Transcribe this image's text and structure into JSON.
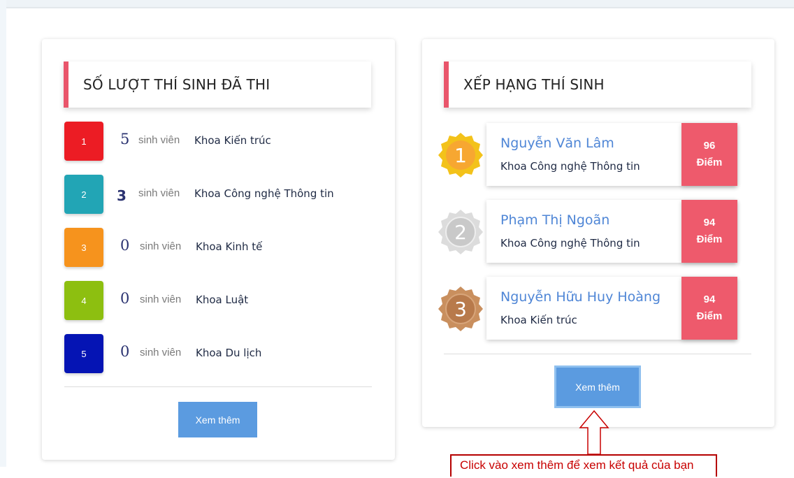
{
  "left_panel": {
    "title": "SỐ LƯỢT THÍ SINH ĐÃ THI",
    "unit_label": "sinh viên",
    "items": [
      {
        "rank": "1",
        "count": "5",
        "department": "Khoa Kiến trúc",
        "color": "#ec1c24"
      },
      {
        "rank": "2",
        "count": "3",
        "department": "Khoa Công nghệ Thông tin",
        "color": "#22a5b5"
      },
      {
        "rank": "3",
        "count": "0",
        "department": "Khoa Kinh tế",
        "color": "#f6931d"
      },
      {
        "rank": "4",
        "count": "0",
        "department": "Khoa Luật",
        "color": "#8dbf10"
      },
      {
        "rank": "5",
        "count": "0",
        "department": "Khoa Du lịch",
        "color": "#0514b4"
      }
    ],
    "more_button": "Xem thêm"
  },
  "right_panel": {
    "title": "XẾP HẠNG THÍ SINH",
    "ranking": [
      {
        "position": "1",
        "name": "Nguyễn Văn Lâm",
        "department": "Khoa Công nghệ Thông tin",
        "score": "96",
        "score_unit": "Điểm",
        "medal": "gold"
      },
      {
        "position": "2",
        "name": "Phạm Thị Ngoãn",
        "department": "Khoa Công nghệ Thông tin",
        "score": "94",
        "score_unit": "Điểm",
        "medal": "silver"
      },
      {
        "position": "3",
        "name": "Nguyễn Hữu Huy Hoàng",
        "department": "Khoa Kiến trúc",
        "score": "94",
        "score_unit": "Điểm",
        "medal": "bronze"
      }
    ],
    "more_button": "Xem thêm"
  },
  "annotation": {
    "callout_text": "Click vào xem thêm để xem kết quả của bạn"
  },
  "colors": {
    "accent": "#e9556b",
    "button": "#5b9be0",
    "score_bg": "#ee5a6c",
    "name": "#4f86d6"
  }
}
